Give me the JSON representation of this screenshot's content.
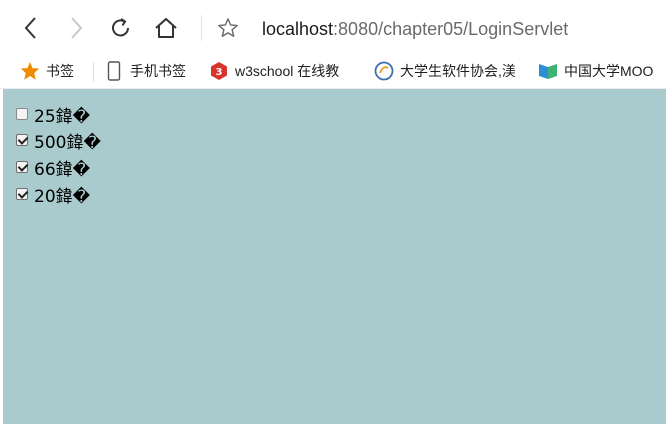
{
  "browser": {
    "url_host": "localhost",
    "url_path": ":8080/chapter05/LoginServlet",
    "icons": [
      "back-arrow-icon",
      "forward-arrow-icon",
      "reload-icon",
      "home-icon",
      "star-icon"
    ]
  },
  "bookmarks": [
    {
      "icon": "star-icon",
      "label": "书签"
    },
    {
      "icon": "phone-icon",
      "label": "手机书签"
    },
    {
      "icon": "w3school-icon",
      "label": "w3school 在线教"
    },
    {
      "icon": "org-logo-icon",
      "label": "大学生软件协会,渼"
    },
    {
      "icon": "book-icon",
      "label": "中国大学MOO"
    }
  ],
  "items": [
    {
      "label": "25鍏�",
      "checked": false
    },
    {
      "label": "500鍏�",
      "checked": true
    },
    {
      "label": "66鍏�",
      "checked": true
    },
    {
      "label": "20鍏�",
      "checked": true
    }
  ],
  "colors": {
    "page_bg": "#aacbcd",
    "star": "#f08a00"
  }
}
